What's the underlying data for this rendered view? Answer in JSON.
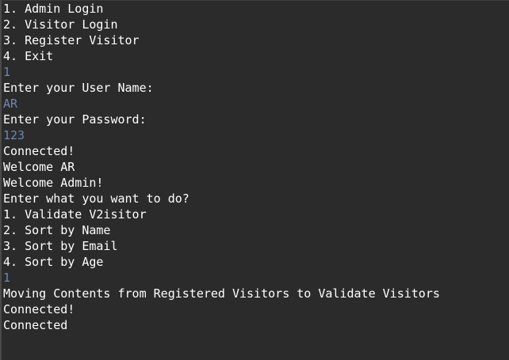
{
  "console": {
    "colors": {
      "background": "#2b2b2b",
      "output_text": "#ffffff",
      "user_input_text": "#6a87b3"
    },
    "lines": [
      {
        "text": "1. Admin Login",
        "kind": "output"
      },
      {
        "text": "2. Visitor Login",
        "kind": "output"
      },
      {
        "text": "3. Register Visitor",
        "kind": "output"
      },
      {
        "text": "4. Exit",
        "kind": "output"
      },
      {
        "text": "1",
        "kind": "input"
      },
      {
        "text": "Enter your User Name:",
        "kind": "output"
      },
      {
        "text": "AR",
        "kind": "input"
      },
      {
        "text": "Enter your Password:",
        "kind": "output"
      },
      {
        "text": "123",
        "kind": "input"
      },
      {
        "text": "Connected!",
        "kind": "output"
      },
      {
        "text": "Welcome AR",
        "kind": "output"
      },
      {
        "text": "Welcome Admin!",
        "kind": "output"
      },
      {
        "text": "Enter what you want to do?",
        "kind": "output"
      },
      {
        "text": "1. Validate V2isitor",
        "kind": "output"
      },
      {
        "text": "2. Sort by Name",
        "kind": "output"
      },
      {
        "text": "3. Sort by Email",
        "kind": "output"
      },
      {
        "text": "4. Sort by Age",
        "kind": "output"
      },
      {
        "text": "1",
        "kind": "input"
      },
      {
        "text": "Moving Contents from Registered Visitors to Validate Visitors",
        "kind": "output"
      },
      {
        "text": "Connected!",
        "kind": "output"
      },
      {
        "text": "Connected",
        "kind": "output"
      }
    ]
  }
}
